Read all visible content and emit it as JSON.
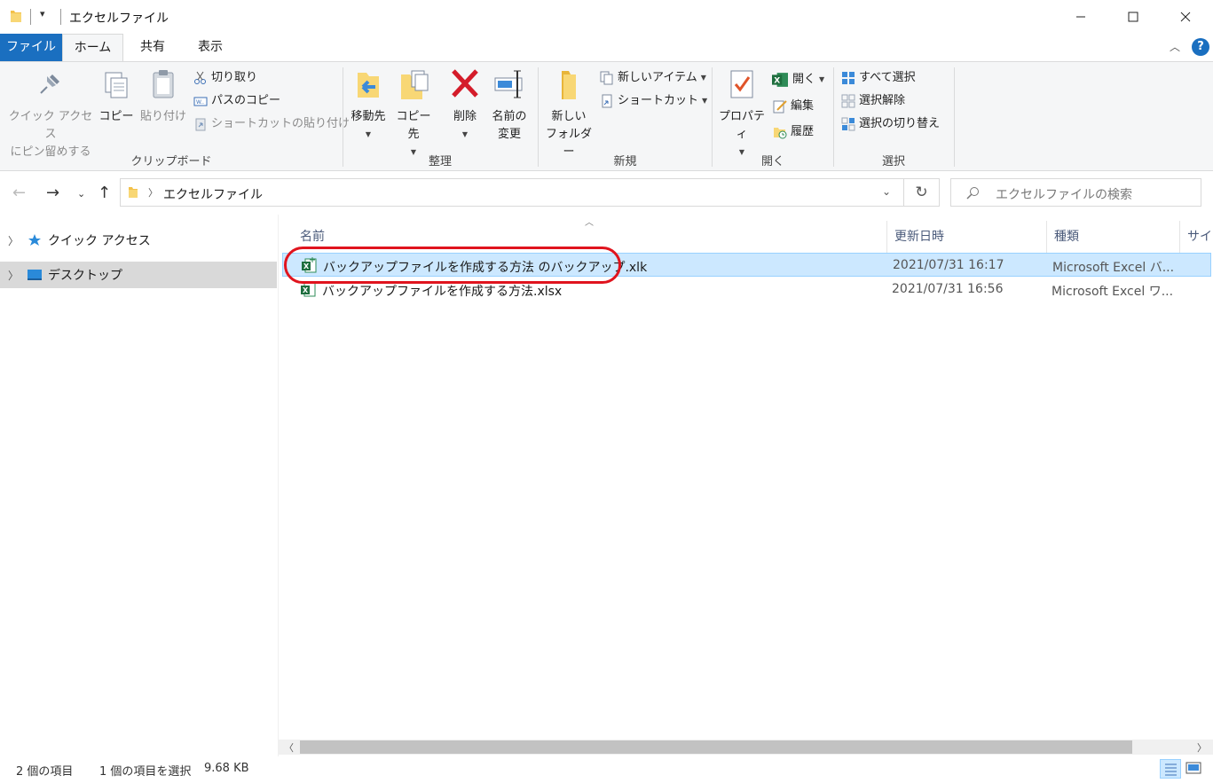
{
  "window": {
    "title": "エクセルファイル",
    "quick_access_caret": "▾",
    "minimize": "—",
    "maximize": "☐",
    "close": "✕"
  },
  "tabs": {
    "file": "ファイル",
    "home": "ホーム",
    "share": "共有",
    "view": "表示",
    "collapse": "︿",
    "help": "?"
  },
  "ribbon": {
    "clipboard": {
      "label": "クリップボード",
      "pin_line1": "クイック アクセス",
      "pin_line2": "にピン留めする",
      "copy": "コピー",
      "paste": "貼り付け",
      "cut": "切り取り",
      "copy_path": "パスのコピー",
      "paste_shortcut": "ショートカットの貼り付け"
    },
    "organize": {
      "label": "整理",
      "move_to": "移動先",
      "copy_to": "コピー先",
      "delete": "削除",
      "rename_line1": "名前の",
      "rename_line2": "変更"
    },
    "new": {
      "label": "新規",
      "new_folder_line1": "新しい",
      "new_folder_line2": "フォルダー",
      "new_item": "新しいアイテム",
      "shortcut": "ショートカット"
    },
    "open": {
      "label": "開く",
      "properties": "プロパティ",
      "open": "開く",
      "edit": "編集",
      "history": "履歴"
    },
    "select": {
      "label": "選択",
      "select_all": "すべて選択",
      "select_none": "選択解除",
      "invert": "選択の切り替え"
    }
  },
  "address": {
    "path": "エクセルファイル",
    "search_placeholder": "エクセルファイルの検索"
  },
  "navpane": {
    "items": [
      {
        "label": "クイック アクセス"
      },
      {
        "label": "デスクトップ"
      }
    ]
  },
  "filelist": {
    "columns": [
      "名前",
      "更新日時",
      "種類",
      "サイズ"
    ],
    "rows": [
      {
        "name": "バックアップファイルを作成する方法 のバックアップ.xlk",
        "date": "2021/07/31 16:17",
        "type": "Microsoft Excel バ...",
        "selected": true
      },
      {
        "name": "バックアップファイルを作成する方法.xlsx",
        "date": "2021/07/31 16:56",
        "type": "Microsoft Excel ワ...",
        "selected": false
      }
    ]
  },
  "status": {
    "count": "2 個の項目",
    "selection": "1 個の項目を選択",
    "size": "9.68 KB"
  },
  "colors": {
    "accent": "#1a6fc0",
    "selected_row": "#cce8ff",
    "highlight_ring": "#e0141e"
  }
}
